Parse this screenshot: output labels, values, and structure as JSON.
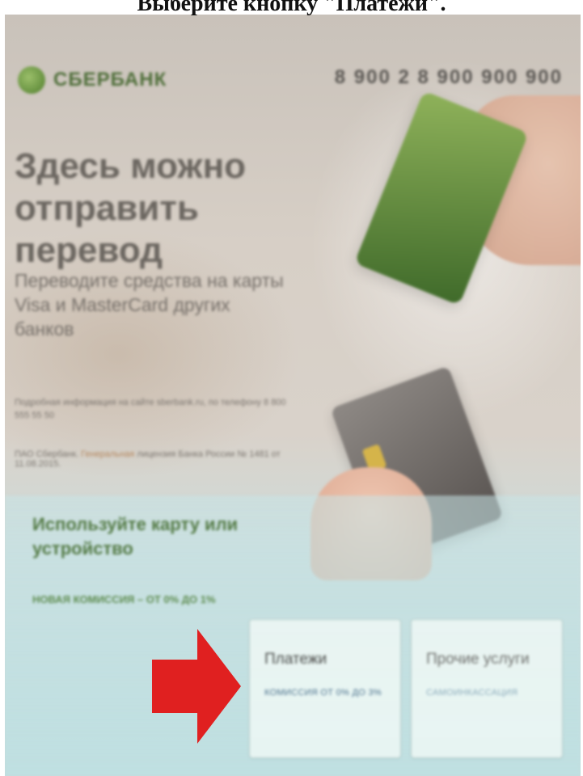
{
  "caption": "Выберите кнопку \"Платежи\".",
  "bank": {
    "logo_text": "СБЕРБАНК",
    "phone": "8 900 2 8 900 900 900"
  },
  "promo": {
    "headline": "Здесь можно отправить перевод",
    "subline": "Переводите средства на карты Visa и MasterCard других банков",
    "fine_print": "Подробная информация на сайте sberbank.ru, по телефону 8 800 555 55 50",
    "license_prefix": "ПАО Сбербанк.",
    "license_highlight": "Генеральная",
    "license_suffix": "лицензия Банка России № 1481 от 11.08.2015."
  },
  "card_prompt": {
    "title": "Используйте карту или устройство",
    "fee": "НОВАЯ КОМИССИЯ – ОТ 0% ДО 1%"
  },
  "tiles": {
    "payments": {
      "title": "Платежи",
      "subtitle": "КОМИССИЯ ОТ 0% ДО 3%"
    },
    "other": {
      "title": "Прочие услуги",
      "subtitle": "САМОИНКАССАЦИЯ"
    }
  },
  "colors": {
    "brand_green": "#4d6d38",
    "arrow_red": "#e02020",
    "panel": "#c5dcdc"
  },
  "icons": {
    "arrow": "right-arrow-icon",
    "logo": "sberbank-logo-icon"
  }
}
